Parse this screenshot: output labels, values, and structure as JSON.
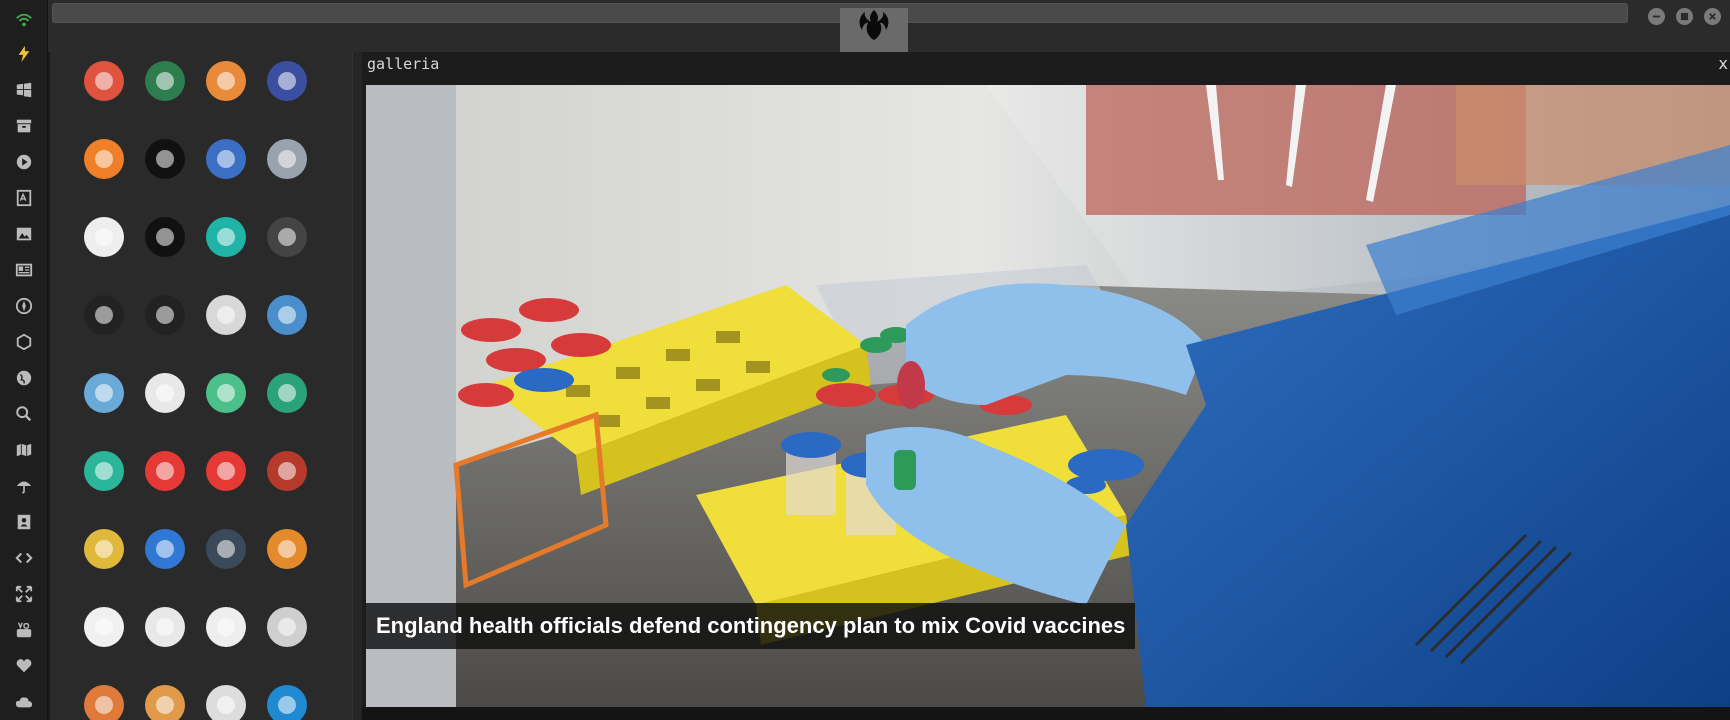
{
  "gallery": {
    "title": "galleria",
    "close_label": "x",
    "caption": "England health officials defend contingency plan to mix Covid vaccines"
  },
  "dock": {
    "items": [
      "wifi-icon",
      "bolt-icon",
      "windows-icon",
      "archive-icon",
      "play-icon",
      "translate-book-icon",
      "image-icon",
      "news-icon",
      "rebel-icon",
      "hexagon-icon",
      "globe-icon",
      "search-icon",
      "map-icon",
      "umbrella-icon",
      "contacts-icon",
      "code-icon",
      "fullscreen-icon",
      "youtube-icon",
      "heart-icon",
      "cloud-icon"
    ]
  },
  "window": {
    "logo": "rebel-alliance-logo",
    "controls": [
      "minimize",
      "maximize",
      "close"
    ]
  },
  "apps": [
    {
      "name": "warning-app-icon",
      "color": "#e0533e"
    },
    {
      "name": "yandex-app-icon",
      "color": "#2e7d4f"
    },
    {
      "name": "search-app-icon",
      "color": "#e88a3a"
    },
    {
      "name": "hourglass-app-icon",
      "color": "#3b4fa0"
    },
    {
      "name": "sublime-app-icon",
      "color": "#f07f2a"
    },
    {
      "name": "terminal-app-icon",
      "color": "#111111"
    },
    {
      "name": "browser-globe-app-icon",
      "color": "#3a6fc4"
    },
    {
      "name": "file-cabinet-app-icon",
      "color": "#9aa3ad"
    },
    {
      "name": "window-app-icon",
      "color": "#eeeeee"
    },
    {
      "name": "shell-app-icon",
      "color": "#111111"
    },
    {
      "name": "cloud-lock-app-icon",
      "color": "#1fb4a6"
    },
    {
      "name": "github-app-icon",
      "color": "#444444"
    },
    {
      "name": "starfleet-app-icon",
      "color": "#222222"
    },
    {
      "name": "death-star-app-icon",
      "color": "#222222"
    },
    {
      "name": "wikipedia-app-icon",
      "color": "#d8d8d8"
    },
    {
      "name": "world-map-app-icon",
      "color": "#4a8ecb"
    },
    {
      "name": "library-app-icon",
      "color": "#6aaad8"
    },
    {
      "name": "reader-app-icon",
      "color": "#e8e8e8"
    },
    {
      "name": "music-app-icon",
      "color": "#4cc08a"
    },
    {
      "name": "video-app-icon",
      "color": "#2aa37a"
    },
    {
      "name": "media-player-app-icon",
      "color": "#2bb59a"
    },
    {
      "name": "youtube-app-icon",
      "color": "#e53935"
    },
    {
      "name": "close-red-app-icon",
      "color": "#e53935"
    },
    {
      "name": "ironman-app-icon",
      "color": "#b63a2b"
    },
    {
      "name": "c3po-app-icon",
      "color": "#e0b93a"
    },
    {
      "name": "translate-app-icon",
      "color": "#2f78d4"
    },
    {
      "name": "calculator-app-icon",
      "color": "#3a4a5a"
    },
    {
      "name": "photo-gallery-app-icon",
      "color": "#e48a2a"
    },
    {
      "name": "chemistry-app-icon",
      "color": "#f0f0f0"
    },
    {
      "name": "sigma-app-icon",
      "color": "#e8e8e8"
    },
    {
      "name": "binary-app-icon",
      "color": "#eeeeee"
    },
    {
      "name": "keyboard-app-icon",
      "color": "#cfcfcf"
    },
    {
      "name": "document-app-icon",
      "color": "#e07a3a"
    },
    {
      "name": "picture-app-icon",
      "color": "#e09a4a"
    },
    {
      "name": "presentation-app-icon",
      "color": "#dddddd"
    },
    {
      "name": "vscode-app-icon",
      "color": "#1f8ad2"
    }
  ]
}
